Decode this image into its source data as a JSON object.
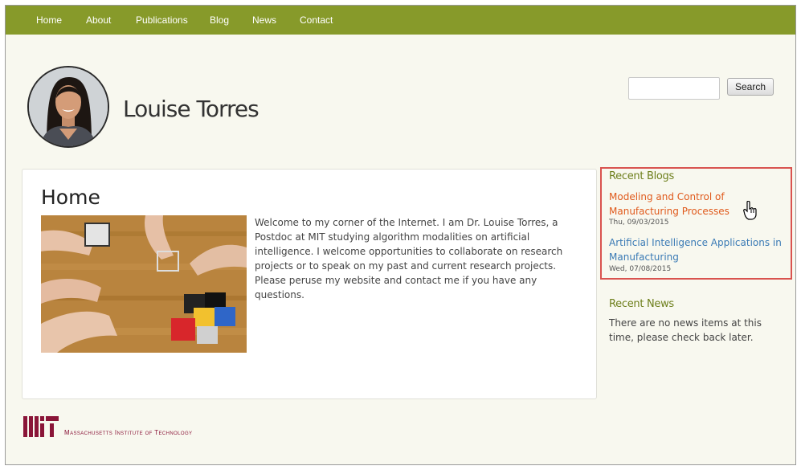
{
  "nav": {
    "items": [
      {
        "label": "Home"
      },
      {
        "label": "About"
      },
      {
        "label": "Publications"
      },
      {
        "label": "Blog"
      },
      {
        "label": "News"
      },
      {
        "label": "Contact"
      }
    ]
  },
  "header": {
    "site_name": "Louise Torres",
    "search": {
      "value": "",
      "button_label": "Search"
    }
  },
  "main": {
    "title": "Home",
    "intro": "Welcome to my corner of the Internet. I am Dr. Louise Torres, a Postdoc at MIT studying algorithm modalities on artificial intelligence. I welcome opportunities to collaborate on research projects or to speak on my past and current research projects. Please peruse my website and contact me if you have any questions."
  },
  "sidebar": {
    "recent_blogs": {
      "title": "Recent Blogs",
      "posts": [
        {
          "title": "Modeling and Control of Manufacturing Processes",
          "date": "Thu, 09/03/2015"
        },
        {
          "title": "Artificial Intelligence Applications in Manufacturing",
          "date": "Wed, 07/08/2015"
        }
      ]
    },
    "recent_news": {
      "title": "Recent News",
      "text": "There are no news items at this time, please check back later."
    }
  },
  "footer": {
    "logo_text": "MIT",
    "institute_name": "Massachusetts Institute of Technology"
  },
  "colors": {
    "nav_bg": "#879a2a",
    "block_title": "#6e7f1c",
    "link_hover": "#e05a1c",
    "link": "#3a7ab5",
    "highlight_border": "#d9534f",
    "mit_red": "#8a1538"
  },
  "icons": [
    "hand-pointer-cursor-icon"
  ]
}
